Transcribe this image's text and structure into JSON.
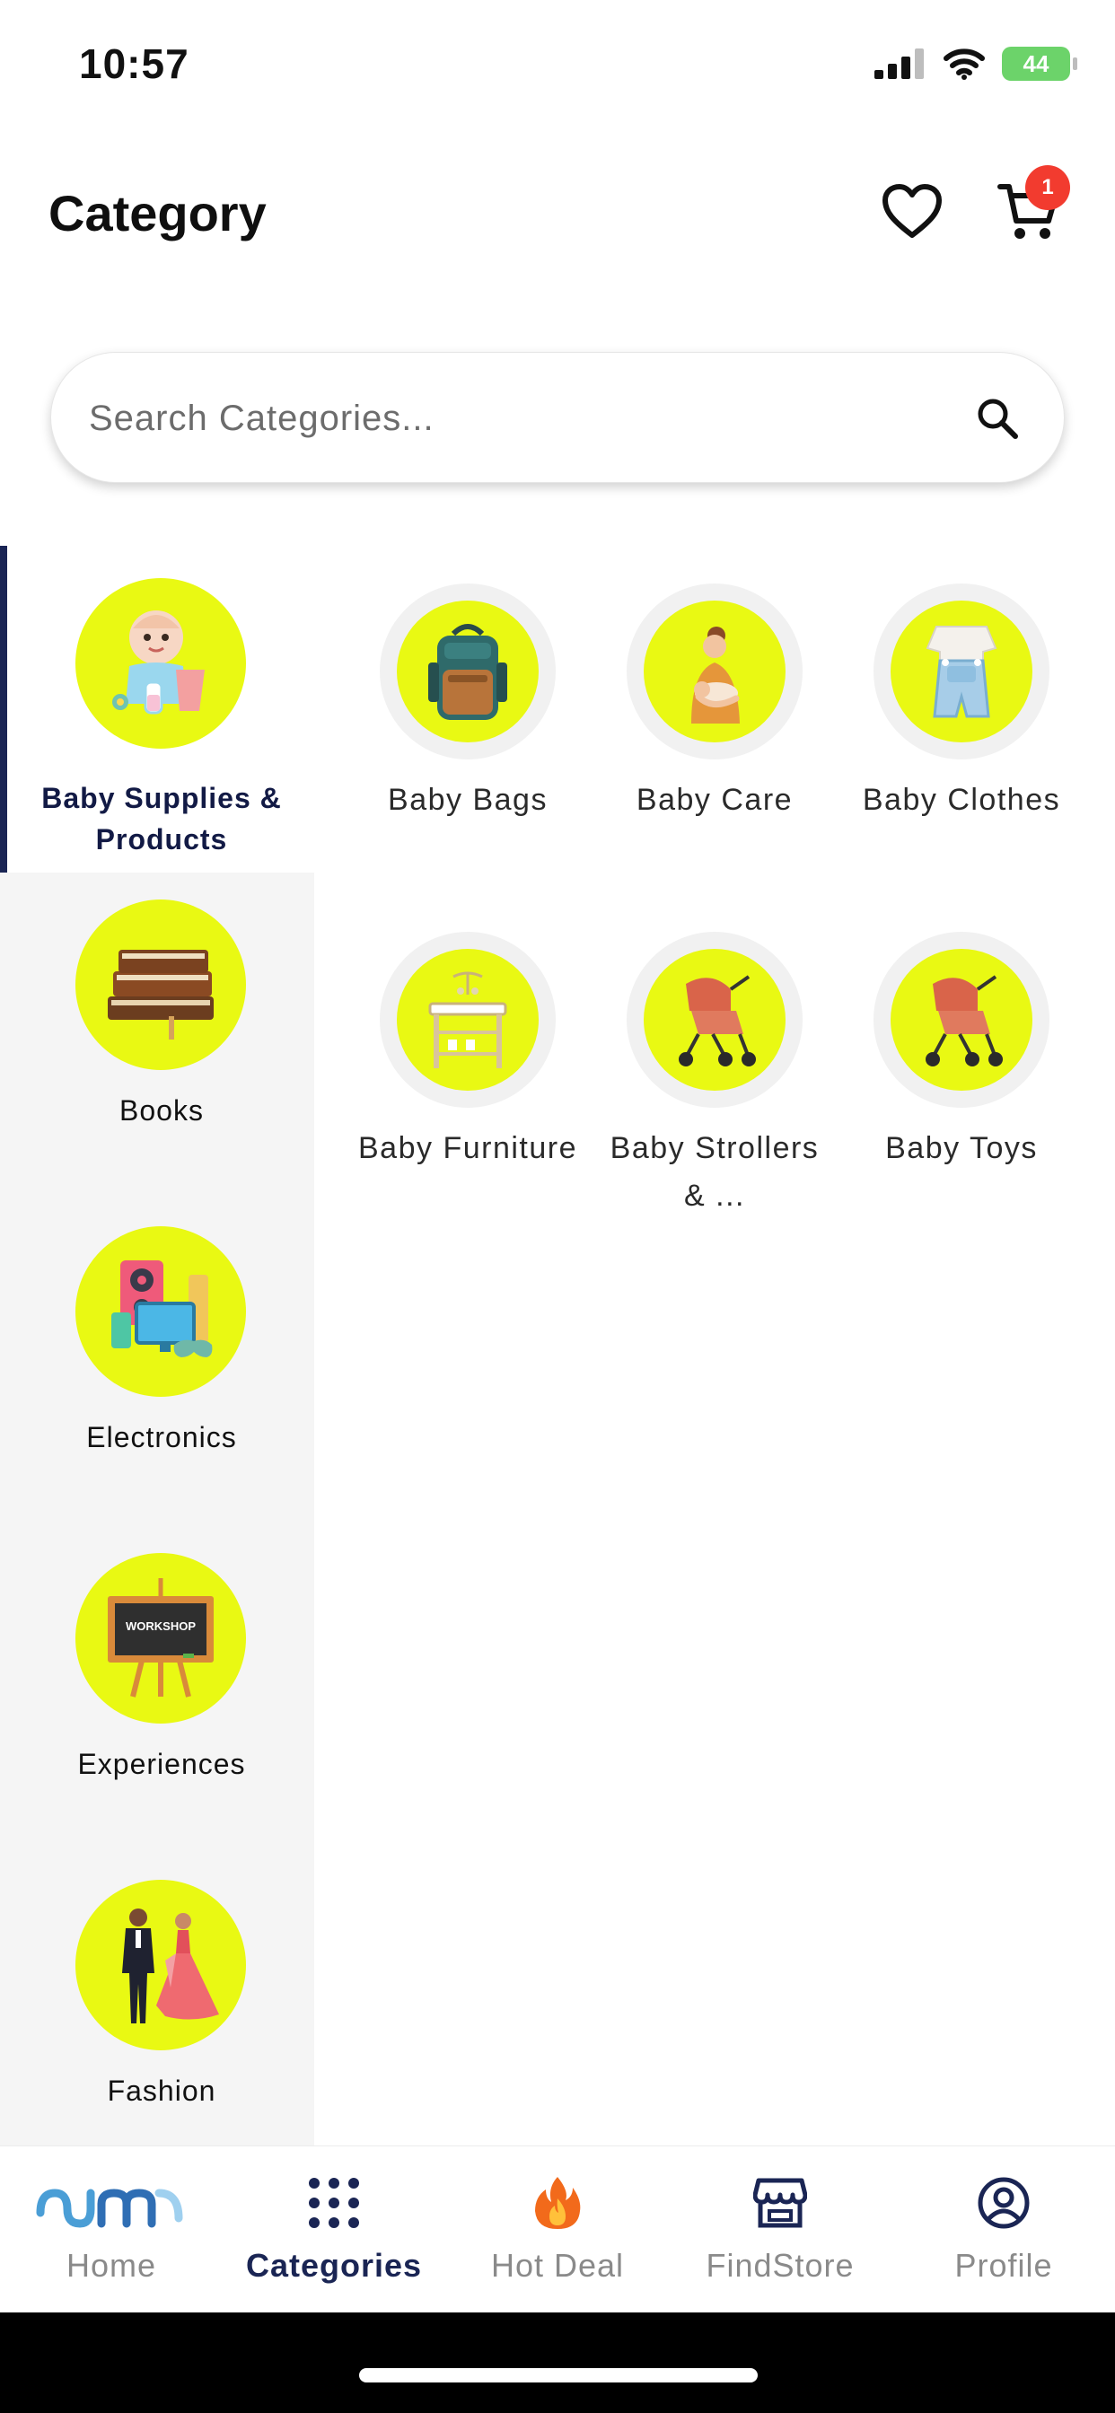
{
  "status_bar": {
    "time": "10:57",
    "battery": "44"
  },
  "header": {
    "title": "Category",
    "cart_count": "1"
  },
  "search": {
    "placeholder": "Search Categories..."
  },
  "sidebar": {
    "items": [
      {
        "label": "Baby Supplies & Products",
        "icon": "baby-icon",
        "active": true
      },
      {
        "label": "Books",
        "icon": "books-icon"
      },
      {
        "label": "Electronics",
        "icon": "electronics-icon"
      },
      {
        "label": "Experiences",
        "icon": "workshop-board-icon",
        "image_text": "WORKSHOP"
      },
      {
        "label": "Fashion",
        "icon": "fashion-couple-icon"
      }
    ]
  },
  "subcategories": [
    {
      "label": "Baby Bags",
      "icon": "backpack-icon"
    },
    {
      "label": "Baby Care",
      "icon": "mother-baby-icon"
    },
    {
      "label": "Baby Clothes",
      "icon": "romper-icon"
    },
    {
      "label": "Baby Furniture",
      "icon": "changing-table-icon"
    },
    {
      "label": "Baby Strollers & ...",
      "icon": "stroller-icon"
    },
    {
      "label": "Baby Toys",
      "icon": "stroller-icon"
    }
  ],
  "bottom_nav": {
    "items": [
      {
        "label": "Home",
        "icon": "home-logo-icon"
      },
      {
        "label": "Categories",
        "icon": "grid-dots-icon",
        "active": true
      },
      {
        "label": "Hot Deal",
        "icon": "fire-icon"
      },
      {
        "label": "FindStore",
        "icon": "store-icon"
      },
      {
        "label": "Profile",
        "icon": "profile-icon"
      }
    ]
  },
  "colors": {
    "accent_navy": "#1a2554",
    "category_yellow": "#e9f913",
    "badge_red": "#f23b2f",
    "battery_green": "#6cd36a"
  }
}
